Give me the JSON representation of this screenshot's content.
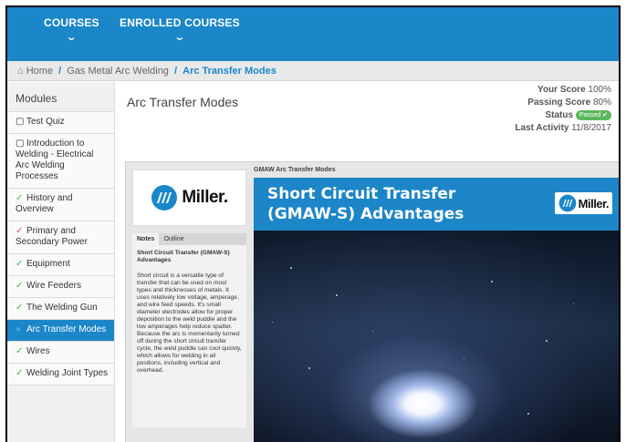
{
  "nav": {
    "courses": "COURSES",
    "enrolled": "ENROLLED COURSES"
  },
  "breadcrumb": {
    "home": "Home",
    "course": "Gas Metal Arc Welding",
    "current": "Arc Transfer Modes"
  },
  "sidebar": {
    "header": "Modules",
    "items": [
      {
        "label": "Test Quiz",
        "icon": "square-icon"
      },
      {
        "label": "Introduction to Welding - Electrical Arc Welding Processes",
        "icon": "square-icon"
      },
      {
        "label": "History and Overview",
        "icon": "check-icon-green"
      },
      {
        "label": "Primary and Secondary Power",
        "icon": "check-icon-red"
      },
      {
        "label": "Equipment",
        "icon": "check-icon-green"
      },
      {
        "label": "Wire Feeders",
        "icon": "check-icon-green"
      },
      {
        "label": "The Welding Gun",
        "icon": "check-icon-green"
      },
      {
        "label": "Arc Transfer Modes",
        "icon": "dot-icon"
      },
      {
        "label": "Wires",
        "icon": "check-icon-green"
      },
      {
        "label": "Welding Joint Types",
        "icon": "check-icon-green"
      }
    ]
  },
  "page": {
    "title": "Arc Transfer Modes"
  },
  "score": {
    "your_score_label": "Your Score",
    "your_score_value": "100%",
    "passing_label": "Passing Score",
    "passing_value": "80%",
    "status_label": "Status",
    "status_value": "Passed",
    "last_activity_label": "Last Activity",
    "last_activity_value": "11/8/2017"
  },
  "player": {
    "brand": "Miller.",
    "tabs": [
      "Notes",
      "Outline"
    ],
    "notes_title": "Short Circuit Transfer (GMAW-S) Advantages",
    "notes_text": "Short circuit is a versatile type of transfer that can be used on most types and thicknesses of metals. It uses relatively low voltage, amperage, and wire feed speeds. It's small diameter electrodes allow for proper deposition to the weld puddle and the low amperages help reduce spatter. Because the arc is momentarily turned off during the short circuit transfer cycle, the weld puddle can cool quickly, which allows for welding in all positions, including vertical and overhead.",
    "slide_header": "GMAW Arc Transfer Modes",
    "slide_title_line1": "Short Circuit Transfer",
    "slide_title_line2": "(GMAW-S) Advantages"
  },
  "colors": {
    "brand_blue": "#1b87c9",
    "passed_green": "#5cb85c"
  }
}
